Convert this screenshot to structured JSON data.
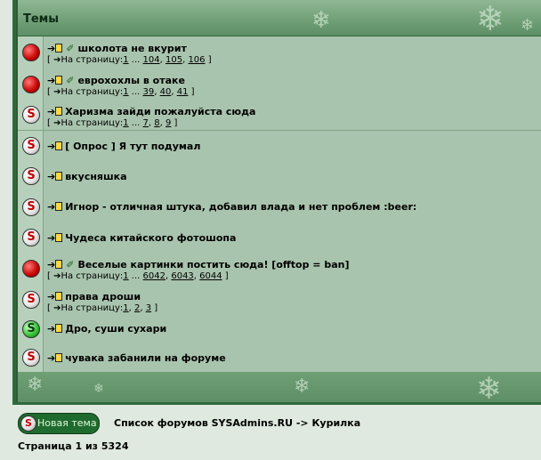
{
  "header": {
    "title": "Темы"
  },
  "topics": [
    {
      "title": "школота не вкурит",
      "status": "hot",
      "attachment": true,
      "pages_prefix": "На страницу:",
      "pages": [
        "1",
        "104",
        "105",
        "106"
      ]
    },
    {
      "title": "еврохохлы в отаке",
      "status": "hot",
      "attachment": true,
      "pages_prefix": "На страницу:",
      "pages": [
        "1",
        "39",
        "40",
        "41"
      ]
    },
    {
      "title": "Харизма зайди пожалуйста сюда",
      "status": "normal",
      "attachment": false,
      "pages_prefix": "На страницу:",
      "pages": [
        "1",
        "7",
        "8",
        "9"
      ]
    },
    {
      "title": "[ Опрос ] Я тут подумал",
      "status": "normal",
      "attachment": false
    },
    {
      "title": "вкусняшка",
      "status": "normal",
      "attachment": false
    },
    {
      "title": "Игнор - отличная штука, добавил влада и нет проблем :beer:",
      "status": "normal",
      "attachment": false
    },
    {
      "title": "Чудеса китайского фотошопа",
      "status": "normal",
      "attachment": false
    },
    {
      "title": "Веселые картинки постить сюда! [offtop = ban]",
      "status": "hot",
      "attachment": true,
      "pages_prefix": "На страницу:",
      "pages": [
        "1",
        "6042",
        "6043",
        "6044"
      ]
    },
    {
      "title": "права дроши",
      "status": "normal",
      "attachment": false,
      "pages_prefix": "На страницу:",
      "pages": [
        "1",
        "2",
        "3"
      ]
    },
    {
      "title": "Дро, суши сухари",
      "status": "green",
      "attachment": false
    },
    {
      "title": "чувака забанили на форуме",
      "status": "normal",
      "attachment": false
    }
  ],
  "bottom": {
    "new_topic_label": "Новая тема",
    "breadcrumb": "Список форумов SYSAdmins.RU -> Курилка",
    "page_count": "Страница 1 из 5324"
  },
  "colors": {
    "frame": "#2f6a3b",
    "row": "#a9c4ae",
    "header": "#6f9f75",
    "hot": "#c80000",
    "button": "#1f6a2e"
  }
}
